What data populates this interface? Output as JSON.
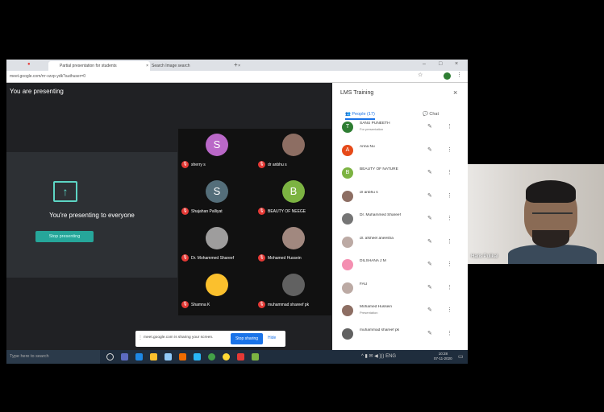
{
  "browser": {
    "tabs": [
      {
        "label": "Partial presentation for students"
      },
      {
        "label": "Search Image search"
      }
    ],
    "url": "meet.google.com/rrr-vzzp-ydk?authuser=0"
  },
  "meet": {
    "presenting_label": "You are presenting",
    "present_text": "You're presenting to everyone",
    "stop_label": "Stop presenting",
    "tiles": [
      {
        "initial": "S",
        "name": "sherry s",
        "color": "#ba68c8"
      },
      {
        "initial": "",
        "name": "dr anbhu s",
        "color": "#8d6e63"
      },
      {
        "initial": "S",
        "name": "Shajahan Palliyat",
        "color": "#546e7a"
      },
      {
        "initial": "B",
        "name": "BEAUTY OF NEEGE",
        "color": "#7cb342"
      },
      {
        "initial": "",
        "name": "Dr. Mohammed Shareef",
        "color": "#9e9d9d"
      },
      {
        "initial": "",
        "name": "Mohamed Hussein",
        "color": "#a1887f"
      },
      {
        "initial": "",
        "name": "Shamna K",
        "color": "#fbc02d"
      },
      {
        "initial": "",
        "name": "muhammad shareef pk",
        "color": "#616161"
      }
    ]
  },
  "side": {
    "title": "LMS Training",
    "tab_people": "People (17)",
    "tab_chat": "Chat",
    "participants": [
      {
        "initial": "T",
        "name": "SANU PUNEETH",
        "sub": "For presentation",
        "color": "#2e7d32"
      },
      {
        "initial": "A",
        "name": "Anna Nu",
        "sub": "",
        "color": "#e64a19"
      },
      {
        "initial": "B",
        "name": "BEAUTY OF NATURE",
        "sub": "",
        "color": "#7cb342"
      },
      {
        "initial": "",
        "name": "dr anbhu s",
        "sub": "",
        "color": "#8d6e63"
      },
      {
        "initial": "",
        "name": "Dr. Muhammed Shareef",
        "sub": "",
        "color": "#757575"
      },
      {
        "initial": "",
        "name": "dr. afsheel aneesha",
        "sub": "",
        "color": "#bcaaa4"
      },
      {
        "initial": "",
        "name": "DILSHANA J M",
        "sub": "",
        "color": "#f48fb1"
      },
      {
        "initial": "",
        "name": "FAU",
        "sub": "",
        "color": "#bcaaa4"
      },
      {
        "initial": "",
        "name": "Mohamed Hussein",
        "sub": "Presentation",
        "color": "#8d6e63"
      },
      {
        "initial": "",
        "name": "muhammad shareef pk",
        "sub": "",
        "color": "#616161"
      }
    ]
  },
  "sharebar": {
    "text": "meet.google.com is sharing your screen.",
    "stop_label": "Stop sharing",
    "hide_label": "Hide"
  },
  "taskbar": {
    "search_placeholder": "Type here to search",
    "time": "10:28",
    "date": "07-11-2020"
  },
  "webcam": {
    "name": "Haris Pulikal"
  }
}
